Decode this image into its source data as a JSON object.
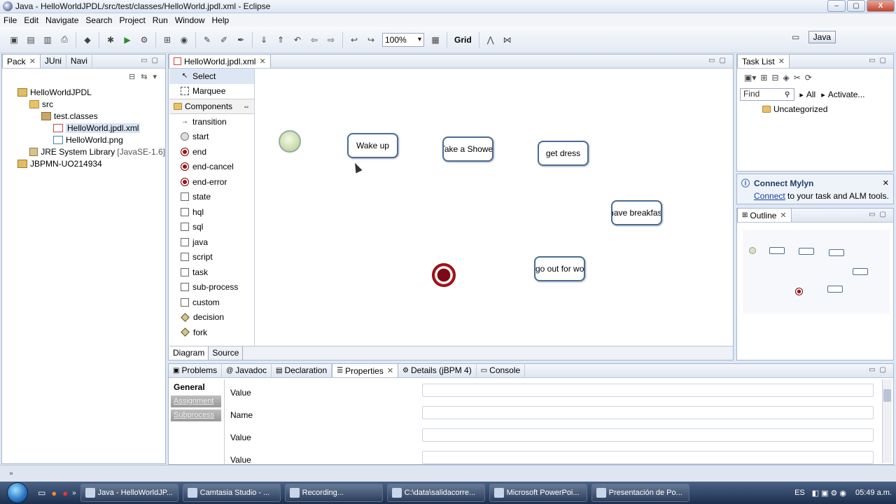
{
  "window": {
    "title": "Java - HelloWorldJPDL/src/test/classes/HelloWorld.jpdl.xml - Eclipse",
    "controls": [
      "–",
      "▢",
      "X"
    ]
  },
  "menu": [
    "File",
    "Edit",
    "Navigate",
    "Search",
    "Project",
    "Run",
    "Window",
    "Help"
  ],
  "toolbar": {
    "zoom": "100%",
    "grid_label": "Grid"
  },
  "perspective": {
    "java_label": "Java"
  },
  "left_panel": {
    "tabs": [
      "Pack",
      "JUni",
      "Navi"
    ],
    "tree": [
      {
        "label": "HelloWorldJPDL",
        "depth": 0,
        "icon": "project-icon"
      },
      {
        "label": "src",
        "depth": 1,
        "icon": "source-folder-icon"
      },
      {
        "label": "test.classes",
        "depth": 2,
        "icon": "package-icon"
      },
      {
        "label": "HelloWorld.jpdl.xml",
        "depth": 3,
        "icon": "jpdl-file-icon"
      },
      {
        "label": "HelloWorld.png",
        "depth": 3,
        "icon": "png-file-icon"
      },
      {
        "label": "JRE System Library",
        "suffix": "[JavaSE-1.6]",
        "depth": 1,
        "icon": "library-icon"
      },
      {
        "label": "JBPMN-UO214934",
        "depth": 0,
        "icon": "project-icon"
      }
    ]
  },
  "editor": {
    "tab_label": "HelloWorld.jpdl.xml",
    "palette": {
      "select": "Select",
      "marquee": "Marquee",
      "components_header": "Components",
      "items": [
        "transition",
        "start",
        "end",
        "end-cancel",
        "end-error",
        "state",
        "hql",
        "sql",
        "java",
        "script",
        "task",
        "sub-process",
        "custom",
        "decision",
        "fork"
      ]
    },
    "nodes": [
      "Wake up",
      "Take a Shower",
      "get dress",
      "have breakfast",
      "go out for work"
    ],
    "bottom_tabs": [
      "Diagram",
      "Source"
    ]
  },
  "task_list": {
    "tab_label": "Task List",
    "find_placeholder": "Find",
    "all_label": "All",
    "activate_label": "Activate...",
    "uncategorized": "Uncategorized"
  },
  "mylyn": {
    "title": "Connect Mylyn",
    "link": "Connect",
    "text": " to your task and ALM tools."
  },
  "outline": {
    "tab_label": "Outline"
  },
  "bottom_panel": {
    "tabs": [
      "Problems",
      "Javadoc",
      "Declaration",
      "Properties",
      "Details (jBPM 4)",
      "Console"
    ],
    "active_tab": "Properties",
    "sections": [
      "General",
      "Assignment",
      "Subprocess"
    ],
    "fields": [
      "Value",
      "Name",
      "Value",
      "Value"
    ]
  },
  "taskbar": {
    "buttons": [
      "Java - HelloWorldJP...",
      "Camtasia Studio - ...",
      "Recording...",
      "C:\\data\\salidacorre...",
      "Microsoft PowerPoi...",
      "Presentación de Po..."
    ],
    "lang": "ES",
    "time": "05:49 a.m."
  }
}
